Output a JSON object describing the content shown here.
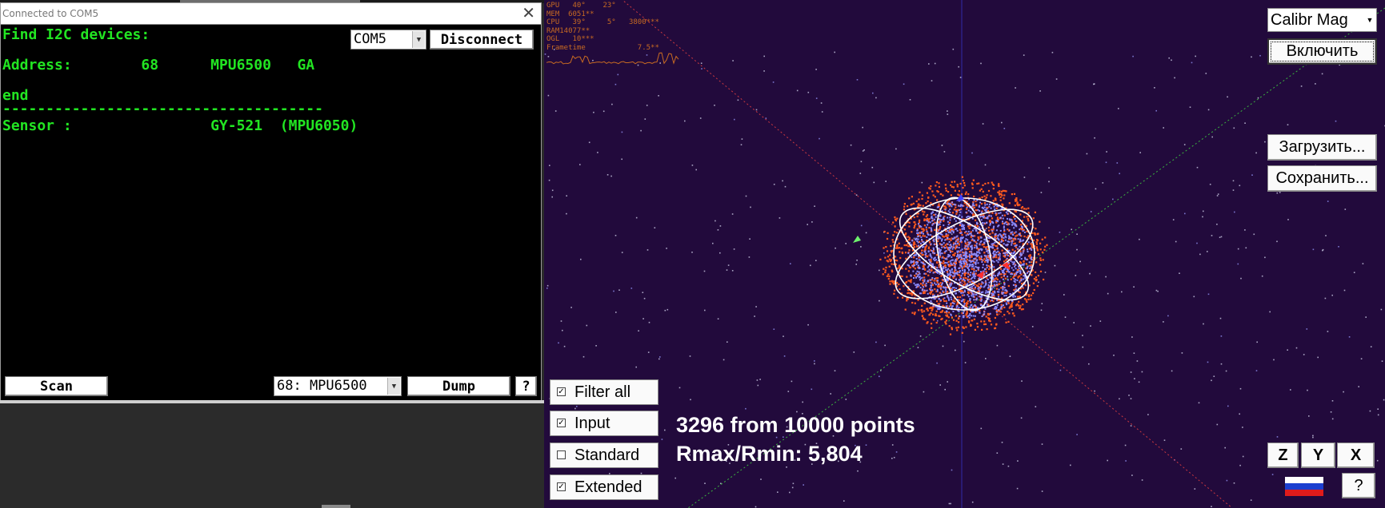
{
  "terminal": {
    "title": "Connected to COM5",
    "close_glyph": "✕",
    "lines": [
      "Find I2C devices:",
      "Address:        68      MPU6500   GA",
      "end",
      "-------------------------------------",
      "Sensor :                GY-521  (MPU6050)"
    ],
    "port_select": "COM5",
    "disconnect_label": "Disconnect",
    "scan_label": "Scan",
    "device_select": "68: MPU6500",
    "dump_label": "Dump",
    "help_label": "?"
  },
  "viewport": {
    "stats": [
      "GPU   40°    23°",
      "MEM  6051**",
      "CPU   39°     5°   3800***",
      "RAM14077**",
      "OGL   10***",
      "Frametime            7.5**"
    ],
    "mode_select": "Calibr Mag",
    "enable_label": "Включить",
    "load_label": "Загрузить...",
    "save_label": "Сохранить...",
    "filters": [
      {
        "label": "Filter all",
        "checked": true
      },
      {
        "label": "Input",
        "checked": true
      },
      {
        "label": "Standard",
        "checked": false
      },
      {
        "label": "Extended",
        "checked": true
      }
    ],
    "points_text": "3296 from 10000 points",
    "ratio_text": "Rmax/Rmin: 5,804",
    "axis_buttons": [
      "Z",
      "Y",
      "X"
    ],
    "help_label": "?",
    "colors": {
      "background": "#220a3c",
      "terminal_text": "#22e522",
      "raw_points": "#ff5a1e",
      "filtered_points": "#8c8cff",
      "ellipse": "#ffffff",
      "stats": "#c76a22"
    },
    "icons": {
      "language": "russia-flag-icon",
      "dropdown": "dropdown-arrow-icon",
      "check": "check-icon"
    }
  }
}
